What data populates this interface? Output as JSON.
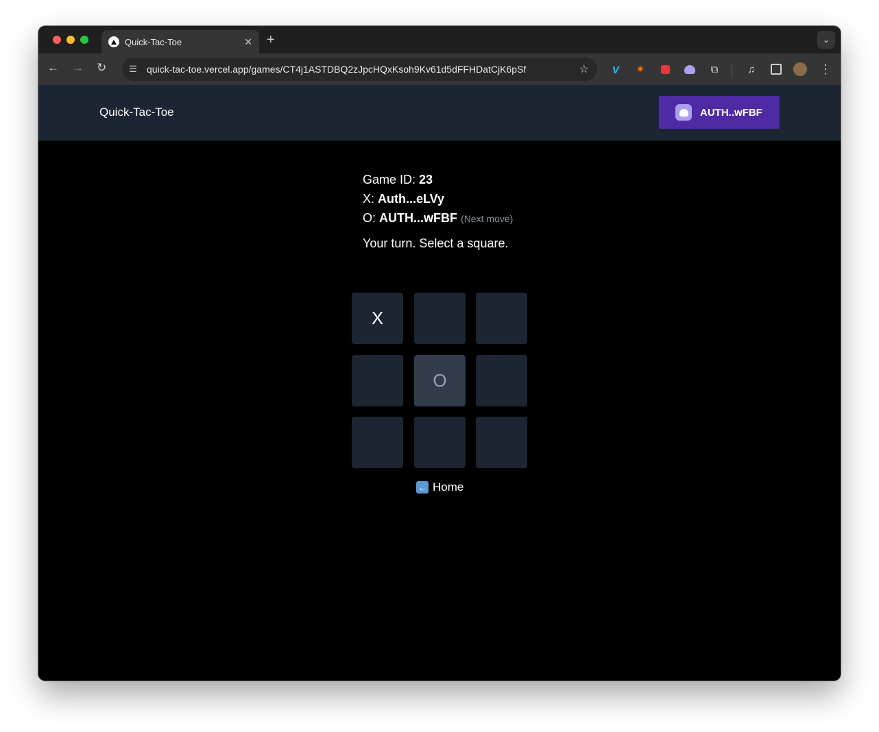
{
  "browser": {
    "tab_title": "Quick-Tac-Toe",
    "url": "quick-tac-toe.vercel.app/games/CT4j1ASTDBQ2zJpcHQxKsoh9Kv61d5dFFHDatCjK6pSf"
  },
  "header": {
    "brand": "Quick-Tac-Toe",
    "wallet_label": "AUTH..wFBF"
  },
  "game": {
    "id_label": "Game ID: ",
    "id": "23",
    "x_label": "X: ",
    "x_player": "Auth...eLVy",
    "o_label": "O: ",
    "o_player": "AUTH...wFBF",
    "next_move": "(Next move)",
    "status": "Your turn. Select a square.",
    "board": [
      "X",
      "",
      "",
      "",
      "O",
      "",
      "",
      "",
      ""
    ]
  },
  "nav": {
    "home_label": "Home"
  },
  "icons": [
    "back-arrow-icon",
    "forward-arrow-icon",
    "reload-icon",
    "site-settings-icon",
    "star-icon",
    "vimeo-icon",
    "spark-icon",
    "lock-extension-icon",
    "phantom-ghost-icon",
    "puzzle-icon",
    "media-control-icon",
    "side-panel-icon",
    "profile-avatar-icon",
    "kebab-menu-icon",
    "left-arrow-icon"
  ],
  "colors": {
    "header_bg": "#1e2532",
    "cell_bg": "#1e2532",
    "cell_active_bg": "#323b4b",
    "wallet_button": "#4e2aa5"
  }
}
